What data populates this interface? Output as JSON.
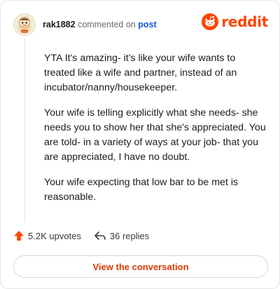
{
  "header": {
    "username": "rak1882",
    "action_text": "commented on",
    "post_link": "post",
    "brand": "reddit",
    "brand_color": "#ff4500"
  },
  "comment": {
    "paragraphs": [
      "YTA It's amazing- it's like your wife wants to treated like a wife and partner, instead of an incubator/nanny/housekeeper.",
      "Your wife is telling explicitly what she needs- she needs you to show her that she's appreciated. You are told- in a variety of ways at your job- that you are appreciated, I have no doubt.",
      "Your wife expecting that low bar to be met is reasonable."
    ]
  },
  "stats": {
    "upvotes": "5.2K upvotes",
    "replies": "36 replies",
    "upvote_icon": "upvote-arrow-icon",
    "reply_icon": "reply-arrow-icon"
  },
  "cta": {
    "label": "View the conversation",
    "color": "#d93a00"
  }
}
